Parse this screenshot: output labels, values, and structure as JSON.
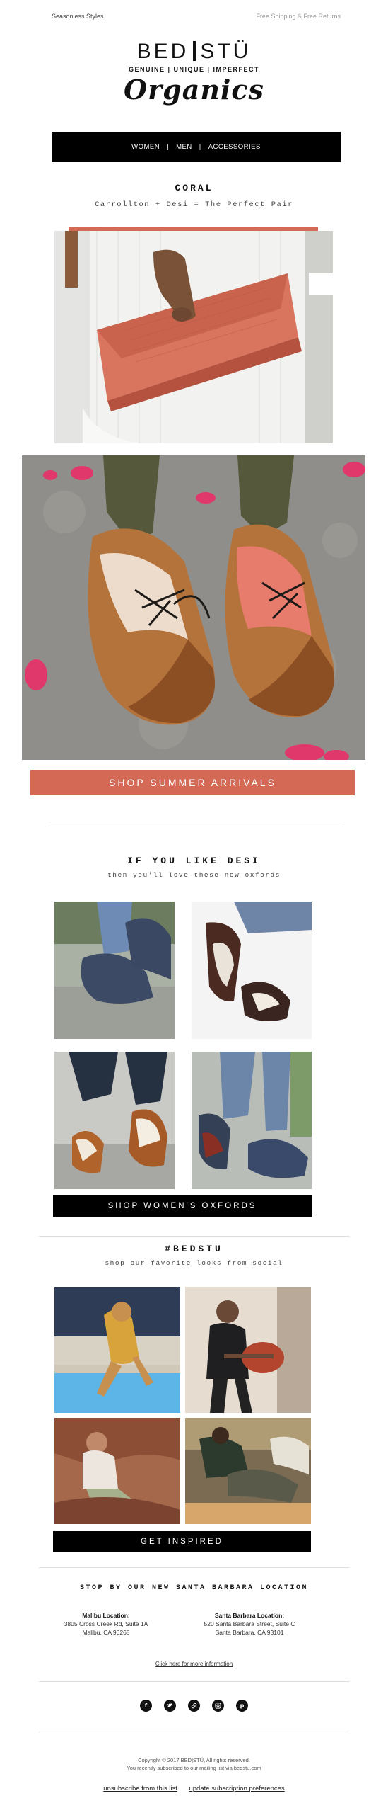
{
  "preheader": {
    "left": "Seasonless Styles",
    "right": "Free Shipping & Free Returns"
  },
  "logo": {
    "brand_left": "BED",
    "brand_right": "STÜ",
    "tagline": "GENUINE | UNIQUE | IMPERFECT",
    "script": "Organics"
  },
  "nav": {
    "items": [
      "WOMEN",
      "MEN",
      "ACCESSORIES"
    ],
    "separator": "|"
  },
  "hero": {
    "title": "CORAL",
    "subtitle": "Carrollton + Desi = The Perfect Pair",
    "cta": "SHOP SUMMER ARRIVALS"
  },
  "oxfords": {
    "title": "IF YOU LIKE DESI",
    "subtitle": "then you'll love these new oxfords",
    "cta": "SHOP WOMEN'S OXFORDS"
  },
  "social_feed": {
    "title": "#BEDSTU",
    "subtitle": "shop our favorite looks from social",
    "cta": "GET INSPIRED"
  },
  "locations": {
    "title": "STOP BY OUR NEW SANTA BARBARA LOCATION",
    "stores": [
      {
        "name": "Malibu Location:",
        "line1": "3805 Cross Creek Rd, Suite 1A",
        "line2": "Malibu, CA 90265"
      },
      {
        "name": "Santa Barbara Location:",
        "line1": "520 Santa Barbara Street, Suite C",
        "line2": "Santa Barbara, CA 93101"
      }
    ],
    "more_link": "Click here for more information"
  },
  "social_icons": [
    "facebook-icon",
    "twitter-icon",
    "pinterest-icon",
    "instagram-icon",
    "link-icon"
  ],
  "footer": {
    "copyright": "Copyright © 2017 BED|STÜ, All rights reserved.",
    "notice": "You recently subscribed to our mailing list via bedstu.com",
    "unsubscribe": "unsubscribe from this list",
    "preferences": "update subscription preferences"
  },
  "colors": {
    "coral": "#d46a55",
    "black": "#000000",
    "leather": "#a8612e"
  }
}
